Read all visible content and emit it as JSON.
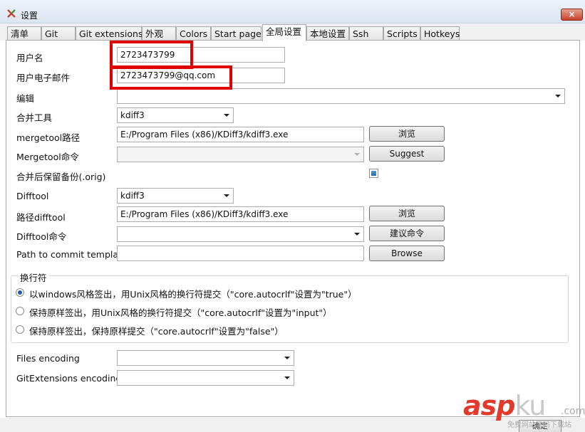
{
  "window": {
    "title": "设置",
    "close_label": "×"
  },
  "tabs": [
    {
      "label": "清单"
    },
    {
      "label": "Git"
    },
    {
      "label": "Git extensions"
    },
    {
      "label": "外观"
    },
    {
      "label": "Colors"
    },
    {
      "label": "Start page"
    },
    {
      "label": "全局设置"
    },
    {
      "label": "本地设置"
    },
    {
      "label": "Ssh"
    },
    {
      "label": "Scripts"
    },
    {
      "label": "Hotkeys"
    }
  ],
  "form": {
    "username": {
      "label": "用户名",
      "value": "2723473799"
    },
    "email": {
      "label": "用户电子邮件",
      "value": "2723473799@qq.com"
    },
    "editor": {
      "label": "编辑",
      "value": ""
    },
    "mergetool": {
      "label": "合并工具",
      "value": "kdiff3"
    },
    "mergetool_path": {
      "label": "mergetool路径",
      "value": "E:/Program Files (x86)/KDiff3/kdiff3.exe",
      "button": "浏览"
    },
    "mergetool_cmd": {
      "label": "Mergetool命令",
      "value": "",
      "button": "Suggest"
    },
    "keep_backup": {
      "label": "合并后保留备份(.orig)",
      "checked": true
    },
    "difftool": {
      "label": "Difftool",
      "value": "kdiff3"
    },
    "difftool_path": {
      "label": "路径difftool",
      "value": "E:/Program Files (x86)/KDiff3/kdiff3.exe",
      "button": "浏览"
    },
    "difftool_cmd": {
      "label": "Difftool命令",
      "value": "",
      "button": "建议命令"
    },
    "commit_template": {
      "label": "Path to commit template",
      "value": "",
      "button": "Browse"
    }
  },
  "line_endings": {
    "title": "换行符",
    "options": [
      {
        "label": "以windows风格签出，用Unix风格的换行符提交（\"core.autocrlf\"设置为\"true\"）",
        "selected": true
      },
      {
        "label": "保持原样签出，用Unix风格的换行符提交（\"core.autocrlf\"设置为\"input\"）",
        "selected": false
      },
      {
        "label": "保持原样签出，保持原样提交（\"core.autocrlf\"设置为\"false\"）",
        "selected": false
      }
    ]
  },
  "encoding": {
    "files": {
      "label": "Files encoding",
      "value": ""
    },
    "gitext": {
      "label": "GitExtensions encoding",
      "value": ""
    }
  },
  "bottom": {
    "ok_label": "确定"
  },
  "watermark": {
    "logo_main": "asp",
    "logo_ku": "ku",
    "logo_com": ".com",
    "sub": "免费网站源码下载站"
  },
  "colors": {
    "highlight": "#e00000",
    "accent": "#1f6fb2"
  }
}
